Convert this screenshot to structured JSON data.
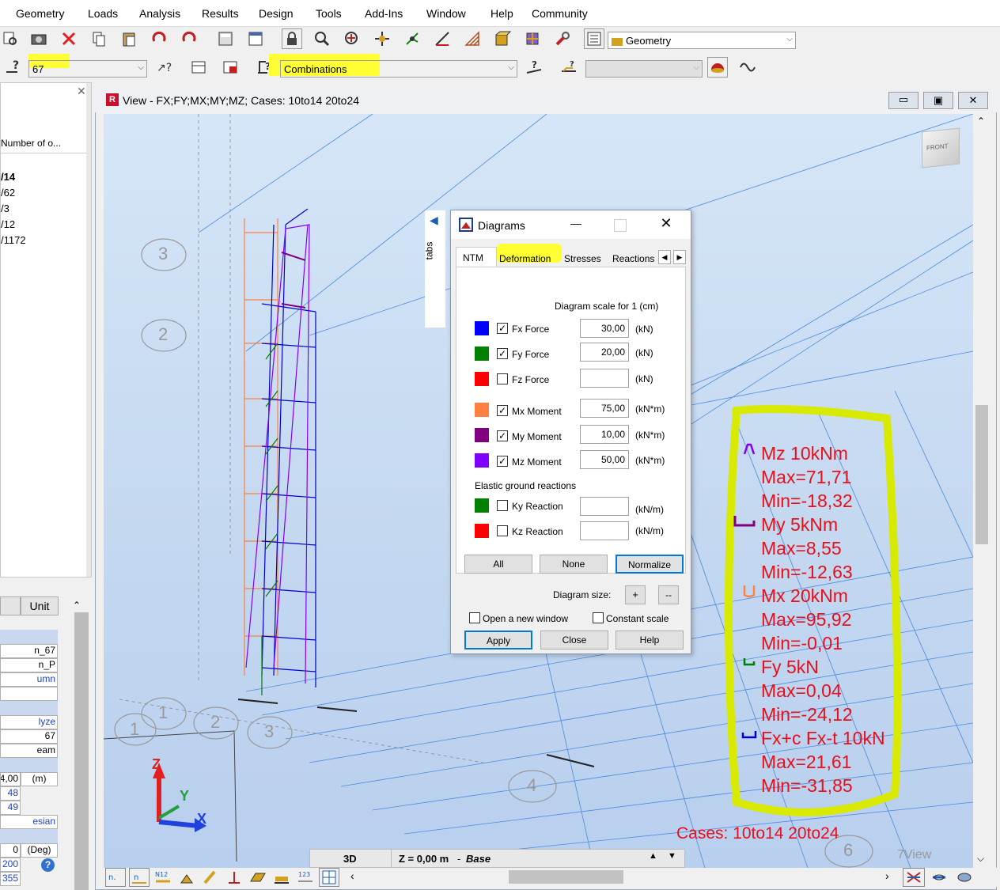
{
  "menu": [
    "Geometry",
    "Loads",
    "Analysis",
    "Results",
    "Design",
    "Tools",
    "Add-Ins",
    "Window",
    "Help",
    "Community"
  ],
  "toolbar": {
    "layout_combo": "Geometry",
    "case_combo": "67",
    "selection_combo": "Combinations"
  },
  "left_panel": {
    "column_header": "Number of o...",
    "rows": [
      "/14",
      "/62",
      "/3",
      "/12",
      "/1172"
    ]
  },
  "props_panel": {
    "unit_header": "Unit",
    "cells_a": [
      "n_67",
      "n_P",
      "umn"
    ],
    "cells_b": [
      "lyze",
      "67",
      "eam"
    ],
    "cells_c": [
      "4,00",
      "48",
      "49",
      "esian"
    ],
    "unit_m": "(m)",
    "unit_deg": "(Deg)",
    "cells_d": [
      "0",
      "200",
      "355"
    ]
  },
  "view": {
    "title": "View - FX;FY;MX;MY;MZ; Cases: 10to14 20to24",
    "viewcube_label": "FRONT",
    "tabs_label": "tabs",
    "axes": [
      "Z",
      "Y",
      "X"
    ],
    "grid_labels": [
      "3",
      "2",
      "1",
      "1",
      "2",
      "3",
      "4",
      "6",
      "7View"
    ]
  },
  "dialog": {
    "title": "Diagrams",
    "tabs": [
      "NTM",
      "Deformation",
      "Stresses",
      "Reactions"
    ],
    "scale_label": "Diagram scale for 1  (cm)",
    "rows": [
      {
        "label": "Fx Force",
        "checked": true,
        "value": "30,00",
        "unit": "(kN)",
        "color": "#0000ff"
      },
      {
        "label": "Fy Force",
        "checked": true,
        "value": "20,00",
        "unit": "(kN)",
        "color": "#008000"
      },
      {
        "label": "Fz Force",
        "checked": false,
        "value": "",
        "unit": "(kN)",
        "color": "#ff0000"
      },
      {
        "label": "Mx Moment",
        "checked": true,
        "value": "75,00",
        "unit": "(kN*m)",
        "color": "#ff8040"
      },
      {
        "label": "My Moment",
        "checked": true,
        "value": "10,00",
        "unit": "(kN*m)",
        "color": "#800080"
      },
      {
        "label": "Mz Moment",
        "checked": true,
        "value": "50,00",
        "unit": "(kN*m)",
        "color": "#8000ff"
      }
    ],
    "elastic_label": "Elastic ground reactions",
    "elastic_rows": [
      {
        "label": "Ky Reaction",
        "checked": false,
        "value": "",
        "unit": "(kN/m)",
        "color": "#008000"
      },
      {
        "label": "Kz Reaction",
        "checked": false,
        "value": "",
        "unit": "(kN/m)",
        "color": "#ff0000"
      }
    ],
    "btn_all": "All",
    "btn_none": "None",
    "btn_normalize": "Normalize",
    "diagram_size_label": "Diagram size:",
    "size_plus": "+",
    "size_minus": "--",
    "open_new_window": "Open a new window",
    "constant_scale": "Constant scale",
    "btn_apply": "Apply",
    "btn_close": "Close",
    "btn_help": "Help"
  },
  "annotation": {
    "lines": [
      "Mz  10kNm",
      "Max=71,71",
      "Min=-18,32",
      "My  5kNm",
      "Max=8,55",
      "Min=-12,63",
      "Mx  20kNm",
      "Max=95,92",
      "Min=-0,01",
      "Fy  5kN",
      "Max=0,04",
      "Min=-24,12",
      "Fx+c Fx-t  10kN",
      "Max=21,61",
      "Min=-31,85"
    ],
    "cases": "Cases: 10to14 20to24"
  },
  "statusbar": {
    "mode": "3D",
    "level": "Z = 0,00 m",
    "level_name": "Base"
  }
}
